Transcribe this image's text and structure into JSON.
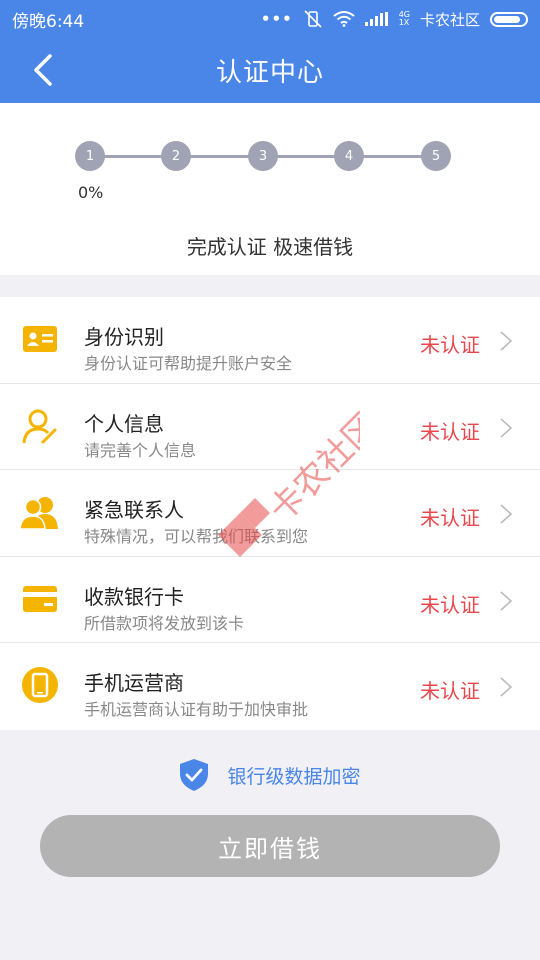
{
  "status_bar": {
    "time": "傍晚6:44",
    "dots": "...",
    "network": "4G\n1X",
    "carrier": "卡农社区"
  },
  "nav": {
    "title": "认证中心",
    "back_icon": "chevron-left-icon"
  },
  "progress": {
    "steps": [
      "1",
      "2",
      "3",
      "4",
      "5"
    ],
    "percent": "0%",
    "slogan": "完成认证 极速借钱"
  },
  "items": [
    {
      "title": "身份识别",
      "desc": "身份认证可帮助提升账户安全",
      "status": "未认证",
      "icon": "id-card-icon"
    },
    {
      "title": "个人信息",
      "desc": "请完善个人信息",
      "status": "未认证",
      "icon": "person-edit-icon"
    },
    {
      "title": "紧急联系人",
      "desc": "特殊情况，可以帮我们联系到您",
      "status": "未认证",
      "icon": "contacts-icon"
    },
    {
      "title": "收款银行卡",
      "desc": "所借款项将发放到该卡",
      "status": "未认证",
      "icon": "bank-card-icon"
    },
    {
      "title": "手机运营商",
      "desc": "手机运营商认证有助于加快审批",
      "status": "未认证",
      "icon": "phone-icon"
    }
  ],
  "secure": {
    "text": "银行级数据加密",
    "icon": "shield-check-icon"
  },
  "button": {
    "label": "立即借钱"
  },
  "watermark": {
    "text": "卡农社区"
  },
  "colors": {
    "primary": "#4a86e8",
    "accent": "#f5b400",
    "danger": "#e8474c",
    "disabled": "#b3b3b3"
  }
}
